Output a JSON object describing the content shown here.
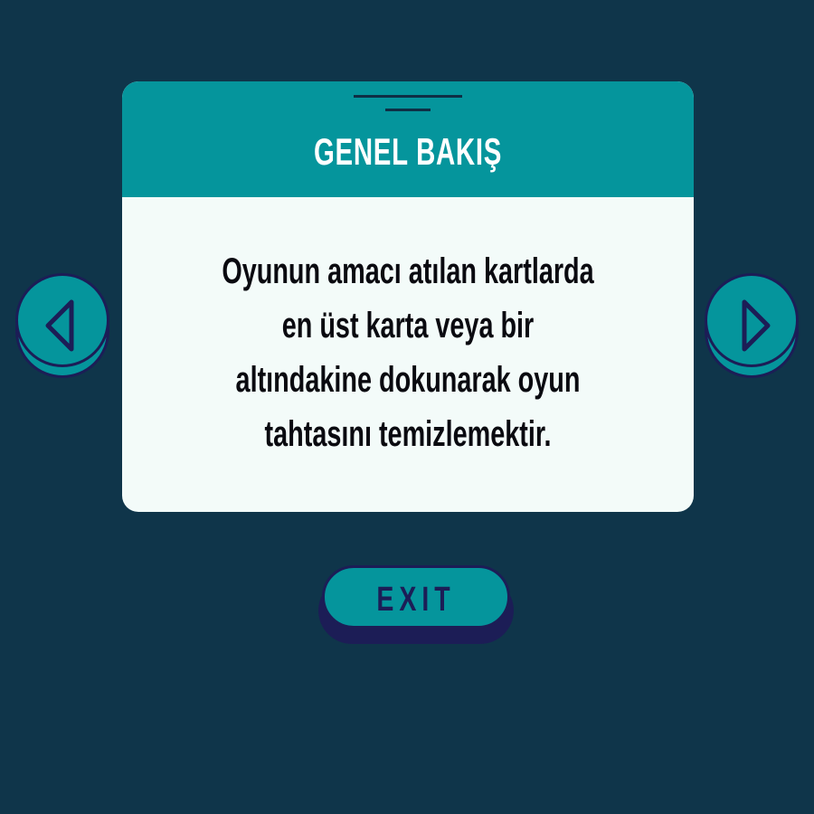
{
  "panel": {
    "title": "GENEL BAKIŞ",
    "body_lines": [
      "Oyunun amacı atılan kartlarda",
      "en üst karta veya bir",
      "altındakine dokunarak oyun",
      "tahtasını temizlemektir."
    ]
  },
  "nav": {
    "prev_icon": "triangle-left-icon",
    "next_icon": "triangle-right-icon"
  },
  "exit": {
    "label": "EXIT"
  },
  "colors": {
    "background": "#0f354a",
    "accent": "#05959c",
    "panel_body": "#f3fbf9",
    "outline": "#1c1d56"
  }
}
